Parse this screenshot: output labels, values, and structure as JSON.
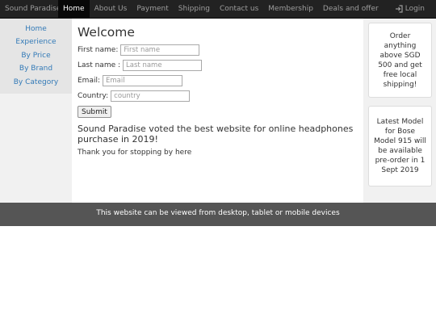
{
  "navbar": {
    "brand": "Sound Paradise",
    "items": [
      {
        "label": "Home"
      },
      {
        "label": "About Us"
      },
      {
        "label": "Payment"
      },
      {
        "label": "Shipping"
      },
      {
        "label": "Contact us"
      },
      {
        "label": "Membership"
      },
      {
        "label": "Deals and offer"
      }
    ],
    "active_index": 0,
    "login_label": "Login",
    "login_icon": "login-icon"
  },
  "sidebar": {
    "items": [
      {
        "label": "Home"
      },
      {
        "label": "Experience"
      },
      {
        "label": "By Price"
      },
      {
        "label": "By Brand"
      },
      {
        "label": "By Category"
      }
    ]
  },
  "main": {
    "title": "Welcome",
    "form": {
      "first_name": {
        "label": "First name:",
        "placeholder": "First name",
        "value": ""
      },
      "last_name": {
        "label": "Last name :",
        "placeholder": "Last name",
        "value": ""
      },
      "email": {
        "label": "Email:",
        "placeholder": "Email",
        "value": ""
      },
      "country": {
        "label": "Country:",
        "placeholder": "country",
        "value": ""
      },
      "submit_label": "Submit"
    },
    "headline": "Sound Paradise voted the best website for online headphones purchase in 2019!",
    "thanks": "Thank you for stopping by here"
  },
  "right_sidebar": {
    "promos": [
      {
        "text": "Order anything above SGD 500 and get free local shipping!"
      },
      {
        "text": "Latest Model for Bose Model 915 will be available pre-order in 1 Sept 2019"
      }
    ]
  },
  "footer": {
    "text": "This website can be viewed from desktop, tablet or mobile devices"
  },
  "colors": {
    "navbar_bg": "#222222",
    "nav_active_bg": "#080808",
    "nav_text": "#9d9d9d",
    "link": "#337ab7",
    "sidebar_bg": "#f1f1f1",
    "footer_bg": "#555555"
  }
}
